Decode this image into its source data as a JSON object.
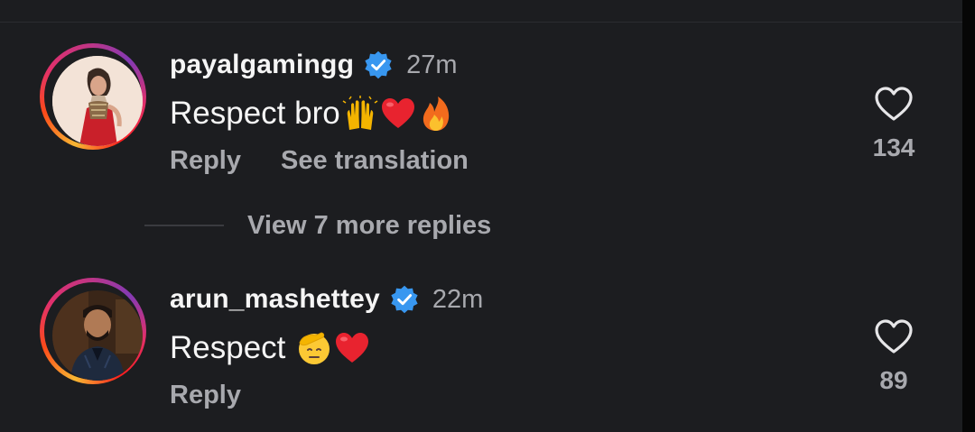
{
  "comments": [
    {
      "username": "payalgamingg",
      "verified": true,
      "time": "27m",
      "text": "Respect bro",
      "emojis": [
        "raising-hands-emoji",
        "red-heart-emoji",
        "fire-emoji"
      ],
      "actions": {
        "reply": "Reply",
        "translate": "See translation"
      },
      "likes": "134",
      "avatar_icon": "woman-red-dress-avatar"
    },
    {
      "username": "arun_mashettey",
      "verified": true,
      "time": "22m",
      "text": "Respect",
      "emojis": [
        "saluting-face-emoji",
        "red-heart-emoji"
      ],
      "actions": {
        "reply": "Reply"
      },
      "likes": "89",
      "avatar_icon": "man-dark-jacket-avatar"
    }
  ],
  "replies": {
    "label": "View 7 more replies"
  },
  "colors": {
    "background": "#1c1d20",
    "text_primary": "#f5f5f5",
    "text_secondary": "#a8a9ae",
    "verified_blue": "#3897f0",
    "story_ring": [
      "#f7b733",
      "#fc4a1a",
      "#e1306c",
      "#833ab4"
    ]
  }
}
